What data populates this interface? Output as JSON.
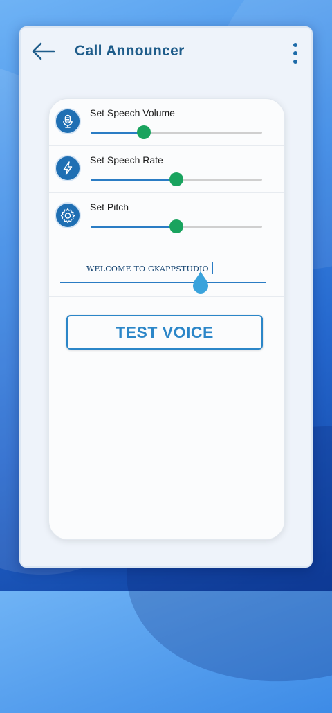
{
  "app": {
    "title": "Call Announcer",
    "accent_color": "#1e5c8a",
    "thumb_color": "#19a35e",
    "track_color": "#2a7cc4"
  },
  "header": {
    "back_icon": "arrow-left-icon",
    "menu_icon": "more-vert-icon"
  },
  "settings": [
    {
      "id": "volume",
      "label": "Set Speech Volume",
      "icon": "microphone-icon",
      "value": 0.31
    },
    {
      "id": "rate",
      "label": "Set Speech Rate",
      "icon": "lightning-icon",
      "value": 0.5
    },
    {
      "id": "pitch",
      "label": "Set Pitch",
      "icon": "gear-icon",
      "value": 0.5
    }
  ],
  "message": {
    "value": "WELCOME TO GKAPPSTUDIO"
  },
  "test_button": {
    "label": "TEST VOICE"
  }
}
